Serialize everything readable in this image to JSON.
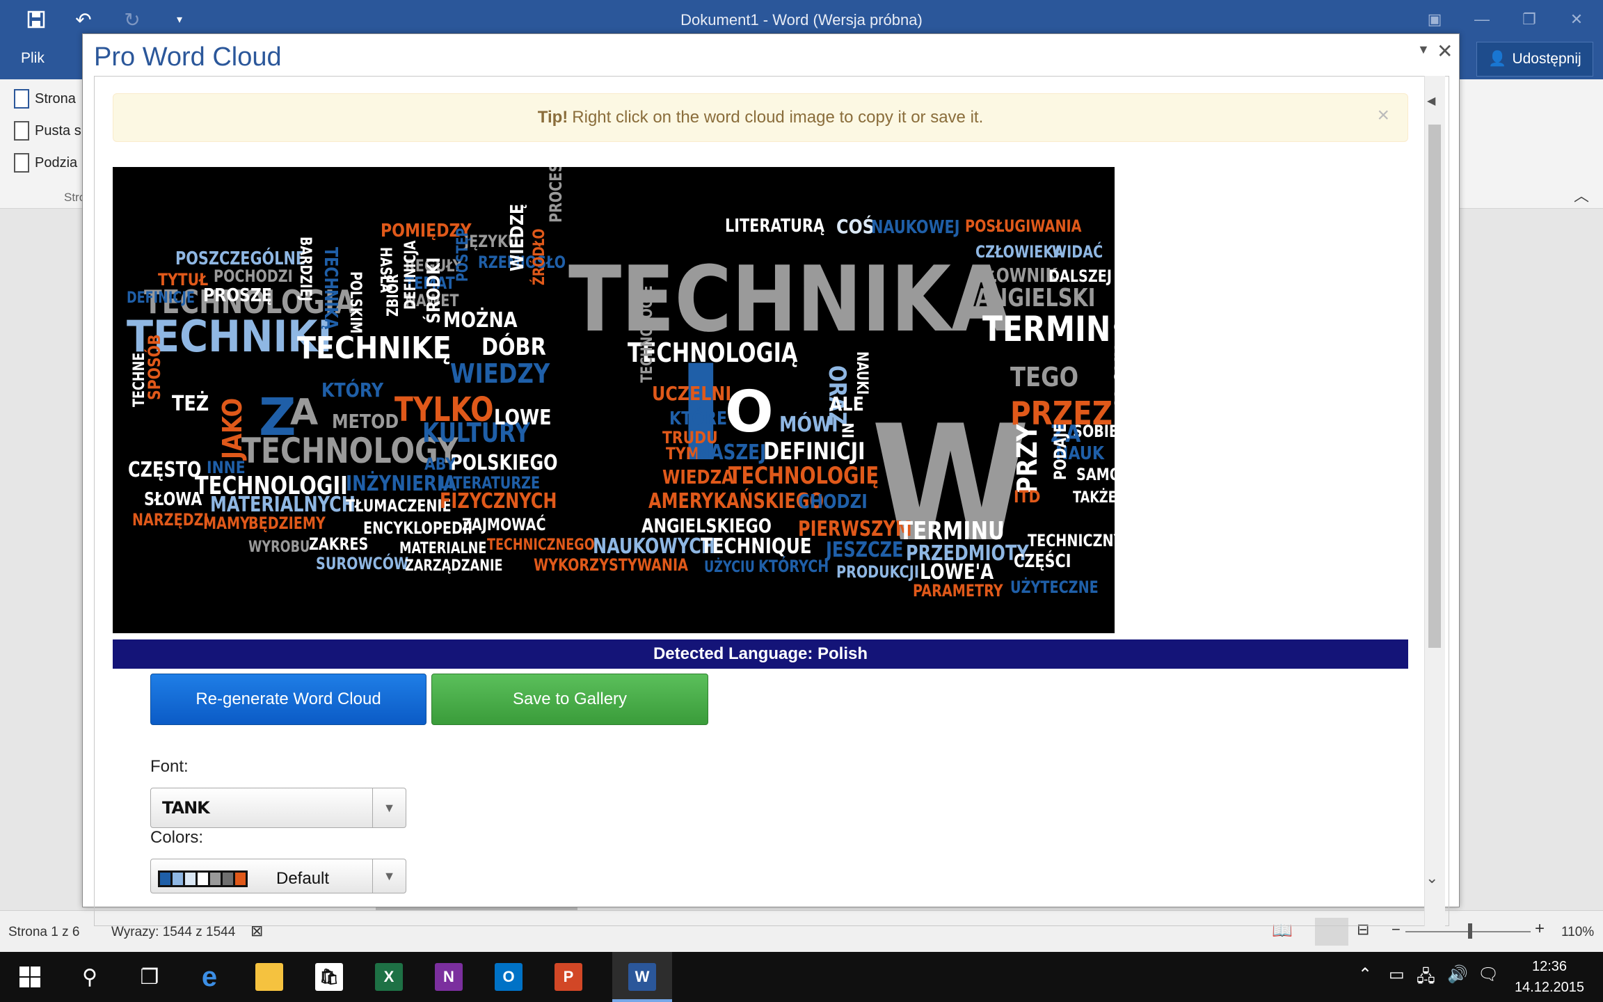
{
  "word": {
    "doc_title": "Dokument1 - Word (Wersja próbna)",
    "file_tab": "Plik",
    "share_label": "Udostępnij",
    "ribbon_items": [
      "Strona",
      "Pusta s",
      "Podzia"
    ],
    "ribbon_group": "Stro"
  },
  "status": {
    "page": "Strona 1 z 6",
    "words": "Wyrazy: 1544 z 1544",
    "zoom": "110%"
  },
  "taskbar": {
    "time": "12:36",
    "date": "14.12.2015"
  },
  "addin": {
    "title": "Pro Word Cloud",
    "tip_bold": "Tip!",
    "tip_text": "Right click on the word cloud image to copy it or save it.",
    "detected_language": "Detected Language: Polish",
    "regen_label": "Re-generate Word Cloud",
    "save_label": "Save to Gallery",
    "font_label": "Font:",
    "font_value": "TANK",
    "colors_label": "Colors:",
    "colors_value": "Default",
    "palette": [
      "#1f5fa8",
      "#8fb7e3",
      "#dbe8f5",
      "#ffffff",
      "#9a9a9a",
      "#6f6f6f",
      "#e0591a"
    ]
  },
  "cloud_words": [
    "TECHNIKA",
    "W",
    "I",
    "TECHNIKI",
    "TECHNOLOGIA",
    "TECHNIKĘ",
    "TECHNOLOGY",
    "TERMIN",
    "TECHNOLOGIĄ",
    "PRZEZ",
    "Z",
    "A",
    "O",
    "TYLKO",
    "JAKO",
    "WIEDZY",
    "KULTURY",
    "TECHNOLOGII",
    "TECHNOLOGIĘ",
    "LITERATURĄ",
    "COŚ",
    "NAUKOWEJ",
    "POSŁUGIWANIA",
    "CZŁOWIEKA",
    "WIDAĆ",
    "SŁOWNIK",
    "DALSZEJ",
    "ANGIELSKI",
    "POMIĘDZY",
    "JĘZYKU",
    "PROCESÓW",
    "POSZCZEGÓLNE",
    "POCHODZI",
    "TYTUŁ",
    "DEFINICJE",
    "PROSZĘ",
    "BARDZIEJ",
    "REGUŁY",
    "TEMAT",
    "NAWET",
    "RZEMIOSŁO",
    "MOŻNA",
    "DÓBR",
    "WIEDZĘ",
    "ŹRÓDŁO",
    "ŚRODKI",
    "KTÓRY",
    "METOD",
    "LOWE",
    "POLSKIEGO",
    "ABY",
    "INNE",
    "CZĘSTO",
    "TEŻ",
    "SPOSÓB",
    "TECHNE",
    "SŁOWA",
    "MATERIALNYCH",
    "TŁUMACZENIE",
    "INŻYNIERIA",
    "LITERATURZE",
    "FIZYCZNYCH",
    "NARZĘDZI",
    "MAMY",
    "BĘDZIEMY",
    "ENCYKLOPEDII",
    "ZAJMOWAĆ",
    "WYROBU",
    "ZAKRES",
    "MATERIALNE",
    "SUROWCÓW",
    "ZARZĄDZANIE",
    "TECHNICZNEGO",
    "NAUKOWYCH",
    "TECHNIQUE",
    "WYKORZYSTYWANIA",
    "UCZELNI",
    "KTÓRE",
    "TRUDU",
    "TYM",
    "NASZEJ",
    "DEFINICJI",
    "WIEDZA",
    "AMERYKAŃSKIEGO",
    "ANGIELSKIEGO",
    "UŻYCIU",
    "KTÓRYCH",
    "PIERWSZYM",
    "JESZCZE",
    "CHODZI",
    "TERMINU",
    "PRZEDMIOTY",
    "PRODUKCJI",
    "LOWE'A",
    "PARAMETRY",
    "TEGO",
    "OZNACZA",
    "SOBIE",
    "NAUK",
    "SAMO",
    "TAKŻE",
    "ZA",
    "PRZY",
    "PODAJE",
    "ITD",
    "TECHNICZNY",
    "CZĘŚCI",
    "UŻYTECZNE",
    "ORAZ",
    "NAUKI",
    "ALE",
    "MÓWI",
    "IN",
    "TECHNOLOGIE",
    "POSTĘP",
    "DEFINICJA",
    "ZBIÓR",
    "HASŁA",
    "POLSKIM",
    "TECHNIKĄ"
  ]
}
